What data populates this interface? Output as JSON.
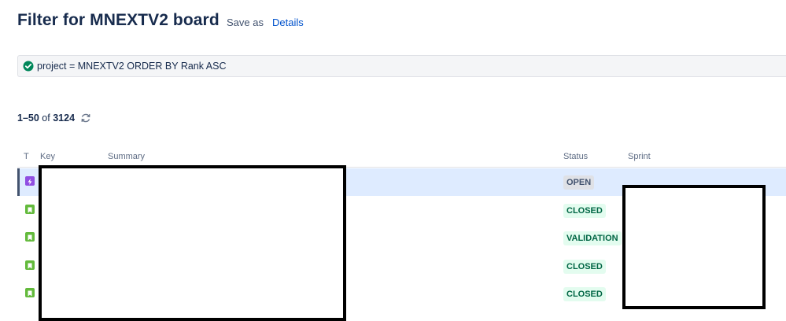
{
  "header": {
    "title": "Filter for MNEXTV2 board",
    "save_as": "Save as",
    "details": "Details"
  },
  "query": {
    "text": "project = MNEXTV2 ORDER BY Rank ASC",
    "status_icon": "check-circle-icon",
    "status_color": "#00875a"
  },
  "results": {
    "range": "1–50",
    "of": "of",
    "total": "3124"
  },
  "table": {
    "columns": [
      "T",
      "Key",
      "Summary",
      "Status",
      "Sprint"
    ],
    "rows": [
      {
        "type": "epic",
        "status": "OPEN"
      },
      {
        "type": "story",
        "status": "CLOSED"
      },
      {
        "type": "story",
        "status": "VALIDATION"
      },
      {
        "type": "story",
        "status": "CLOSED"
      },
      {
        "type": "story",
        "status": "CLOSED"
      }
    ]
  },
  "colors": {
    "epic": "#904ee2",
    "story": "#63ba3c",
    "link": "#0052cc",
    "selected_row": "#deebff"
  }
}
